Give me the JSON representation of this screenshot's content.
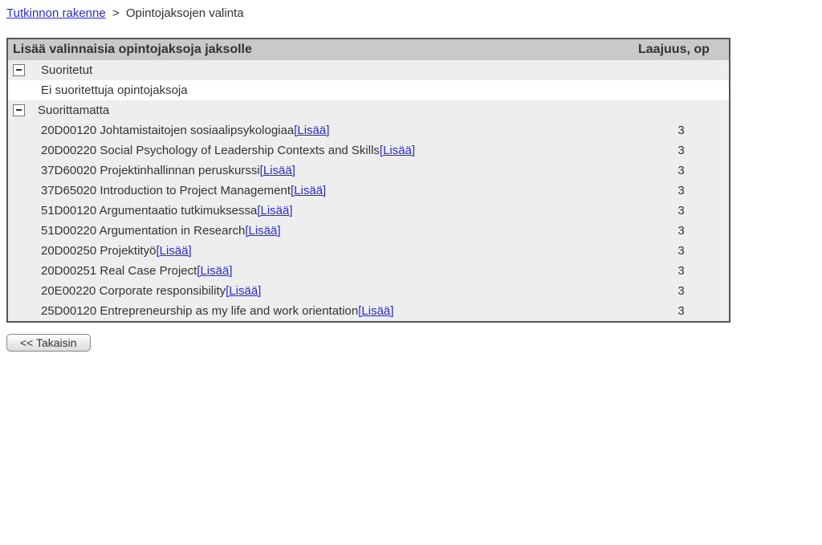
{
  "breadcrumb": {
    "link_text": "Tutkinnon rakenne",
    "separator": ">",
    "current": "Opintojaksojen valinta"
  },
  "table": {
    "header_title": "Lisää valinnaisia opintojaksoja jaksolle",
    "header_credits": "Laajuus, op",
    "section_completed": "Suoritetut",
    "no_completed": "Ei suoritettuja opintojaksoja",
    "section_pending": "Suorittamatta",
    "add_link": "[Lisää]",
    "courses": [
      {
        "name": "20D00120 Johtamistaitojen sosiaalipsykologiaa",
        "credits": "3"
      },
      {
        "name": "20D00220 Social Psychology of Leadership Contexts and Skills",
        "credits": "3"
      },
      {
        "name": "37D60020 Projektinhallinnan peruskurssi",
        "credits": "3"
      },
      {
        "name": "37D65020 Introduction to Project Management",
        "credits": "3"
      },
      {
        "name": "51D00120 Argumentaatio tutkimuksessa",
        "credits": "3"
      },
      {
        "name": "51D00220 Argumentation in Research",
        "credits": "3"
      },
      {
        "name": "20D00250 Projektityö",
        "credits": "3"
      },
      {
        "name": "20D00251 Real Case Project",
        "credits": "3"
      },
      {
        "name": "20E00220 Corporate responsibility",
        "credits": "3"
      },
      {
        "name": "25D00120 Entrepreneurship as my life and work orientation",
        "credits": "3"
      }
    ]
  },
  "buttons": {
    "back": "<< Takaisin"
  }
}
